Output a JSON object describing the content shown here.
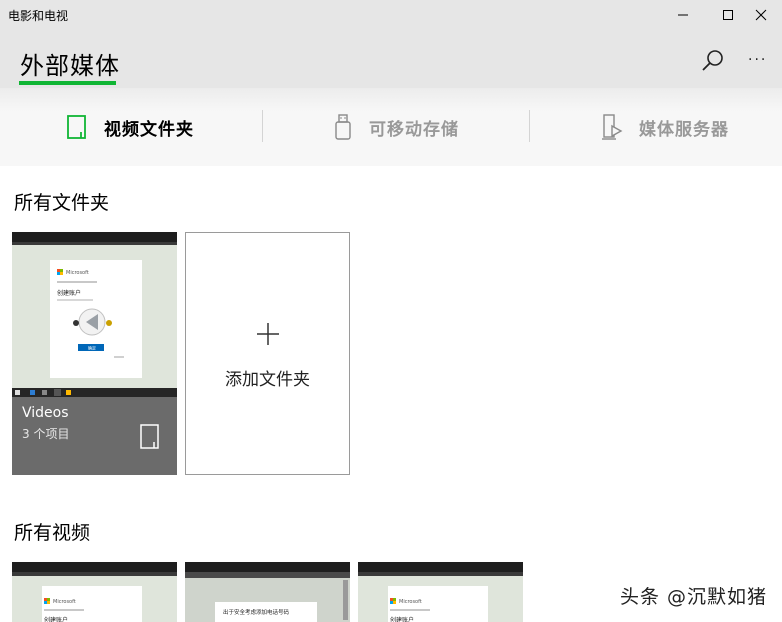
{
  "window": {
    "app_title": "电影和电视",
    "minimize_icon": "minimize-icon",
    "maximize_icon": "maximize-icon",
    "close_icon": "close-icon"
  },
  "header": {
    "title": "外部媒体",
    "accent_color": "#10b534",
    "search_icon": "search-icon",
    "more_label": "···"
  },
  "tabs": [
    {
      "label": "视频文件夹",
      "icon": "folder-phone-icon",
      "active": true
    },
    {
      "label": "可移动存储",
      "icon": "usb-drive-icon",
      "active": false
    },
    {
      "label": "媒体服务器",
      "icon": "media-server-icon",
      "active": false
    }
  ],
  "folders_section": {
    "title": "所有文件夹",
    "folders": [
      {
        "name": "Videos",
        "count": "3 个项目"
      }
    ],
    "add_label": "添加文件夹"
  },
  "thumbnail_text": {
    "brand": "Microsoft",
    "heading": "创建账户",
    "button": "确定",
    "security_prompt": "出于安全考虑添加电话号码"
  },
  "videos_section": {
    "title": "所有视频"
  },
  "watermark": "头条 @沉默如猪"
}
